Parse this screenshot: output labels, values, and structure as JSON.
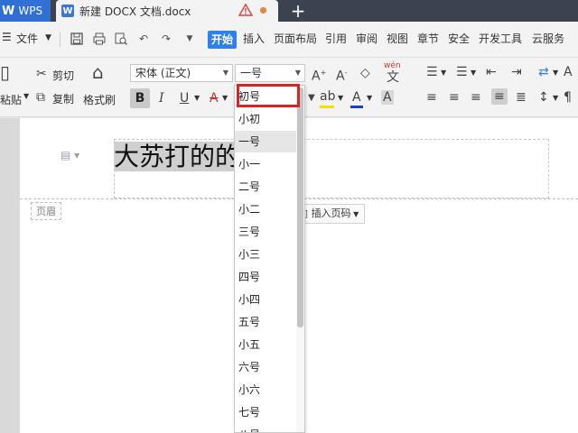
{
  "tabs": {
    "app_label": "WPS",
    "doc_title": "新建 DOCX 文档.docx",
    "add_label": "+"
  },
  "menu": {
    "file_label": "文件",
    "items": [
      "开始",
      "插入",
      "页面布局",
      "引用",
      "审阅",
      "视图",
      "章节",
      "安全",
      "开发工具",
      "云服务"
    ]
  },
  "ribbon": {
    "cut_label": "剪切",
    "copy_label": "复制",
    "paste_label": "粘贴",
    "format_painter_label": "格式刷",
    "font_name": "宋体 (正文)",
    "font_size": "一号",
    "phonetic_label": "wén"
  },
  "document": {
    "body_text": "大苏打的的",
    "header_tag": "页眉",
    "insert_page_label": "插入页码"
  },
  "font_size_dropdown": {
    "options": [
      "初号",
      "小初",
      "一号",
      "小一",
      "二号",
      "小二",
      "三号",
      "小三",
      "四号",
      "小四",
      "五号",
      "小五",
      "六号",
      "小六",
      "七号",
      "八号"
    ],
    "selected": "一号",
    "highlighted": "初号"
  },
  "colors": {
    "accent": "#2f80ed",
    "highlight_box": "#d92424",
    "font_color_bar": "#1a3bd6",
    "highlight_bar": "#f2e200",
    "tab_bar": "#3b4250"
  }
}
